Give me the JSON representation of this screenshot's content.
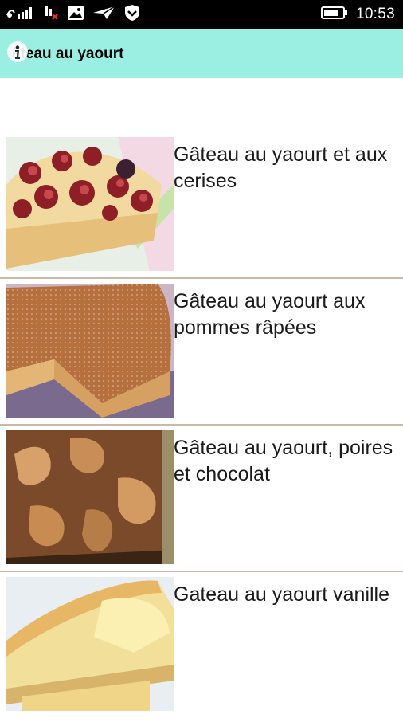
{
  "status_bar": {
    "time": "10:53",
    "icons": [
      "signal-icon",
      "no-sim-icon",
      "image-icon",
      "send-icon",
      "vpn-shield-icon",
      "battery-icon"
    ]
  },
  "app_bar": {
    "title": "âteau au yaourt",
    "background": "#9aeee2",
    "icon": "info-icon"
  },
  "recipes": [
    {
      "title": "Gâteau au yaourt et aux cerises"
    },
    {
      "title": "Gâteau au yaourt aux pommes râpées"
    },
    {
      "title": "Gâteau au yaourt, poires et chocolat"
    },
    {
      "title": "Gateau au yaourt vanille"
    }
  ]
}
